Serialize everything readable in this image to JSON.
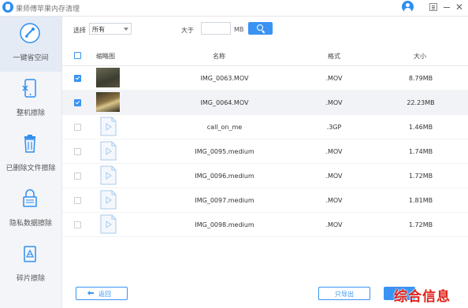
{
  "window": {
    "title": "果师傅苹果内存清理"
  },
  "sidebar": {
    "items": [
      {
        "label": "一键省空间",
        "icon": "clean-space-icon",
        "active": true
      },
      {
        "label": "整机擦除",
        "icon": "phone-erase-icon",
        "active": false
      },
      {
        "label": "已删除文件擦除",
        "icon": "trash-icon",
        "active": false
      },
      {
        "label": "隐私数据擦除",
        "icon": "privacy-lock-icon",
        "active": false
      },
      {
        "label": "碎片擦除",
        "icon": "fragment-icon",
        "active": false
      }
    ]
  },
  "filter": {
    "select_label": "选择",
    "select_value": "所有",
    "size_label": "大于",
    "size_value": "",
    "unit": "MB"
  },
  "table": {
    "headers": {
      "thumb": "缩略图",
      "name": "名称",
      "format": "格式",
      "size": "大小"
    },
    "rows": [
      {
        "name": "IMG_0063.MOV",
        "format": ".MOV",
        "size": "8.79MB",
        "checked": true,
        "thumb": "video"
      },
      {
        "name": "IMG_0064.MOV",
        "format": ".MOV",
        "size": "22.23MB",
        "checked": true,
        "thumb": "video"
      },
      {
        "name": "call_on_me",
        "format": ".3GP",
        "size": "1.46MB",
        "checked": false,
        "thumb": "file"
      },
      {
        "name": "IMG_0095.medium",
        "format": ".MOV",
        "size": "1.74MB",
        "checked": false,
        "thumb": "file"
      },
      {
        "name": "IMG_0096.medium",
        "format": ".MOV",
        "size": "1.72MB",
        "checked": false,
        "thumb": "file"
      },
      {
        "name": "IMG_0097.medium",
        "format": ".MOV",
        "size": "1.81MB",
        "checked": false,
        "thumb": "file"
      },
      {
        "name": "IMG_0098.medium",
        "format": ".MOV",
        "size": "1.72MB",
        "checked": false,
        "thumb": "file"
      }
    ]
  },
  "buttons": {
    "back": "返回",
    "export": "只导出"
  },
  "watermark": "综合信息",
  "colors": {
    "accent": "#3a93f2",
    "sidebar_bg": "#f3f5f9",
    "sidebar_active": "#e4ebf5",
    "watermark": "#e0221a"
  }
}
